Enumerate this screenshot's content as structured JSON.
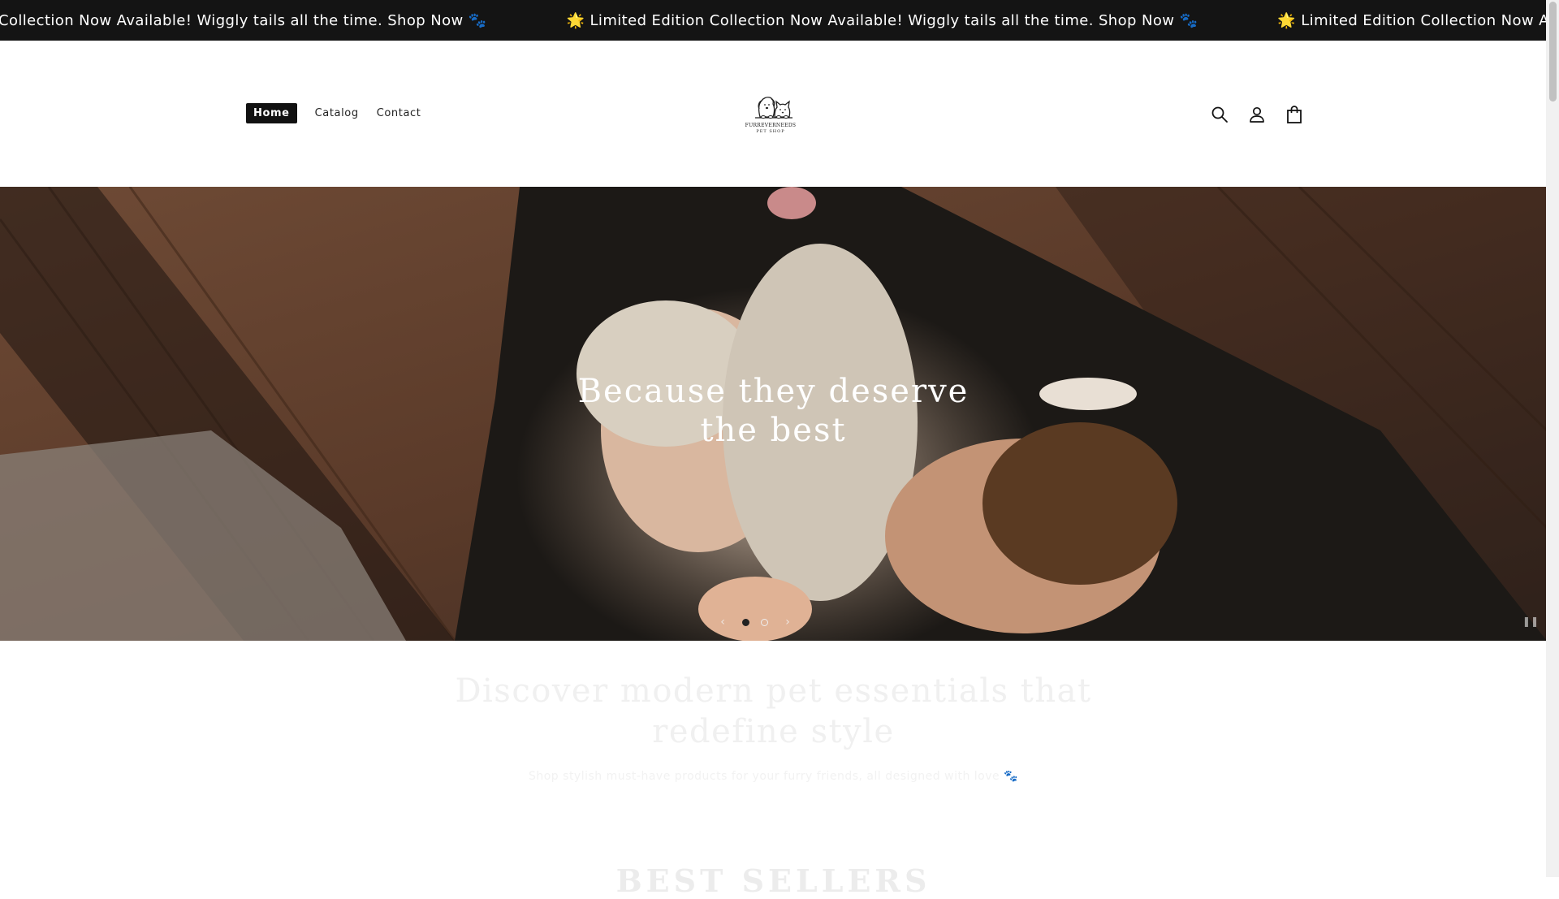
{
  "announcement": {
    "items": [
      "Collection Now Available! Wiggly tails all the time. Shop Now 🐾",
      "🌟 Limited Edition Collection Now Available! Wiggly tails all the time. Shop Now 🐾",
      "🌟 Limited Edition Collection Now Available! Wiggly tails all the time"
    ]
  },
  "nav": {
    "home": "Home",
    "catalog": "Catalog",
    "contact": "Contact"
  },
  "logo": {
    "name": "FURREVERNEEDS",
    "sub": "PET SHOP"
  },
  "hero": {
    "heading_line1": "Because they deserve",
    "heading_line2": "the best",
    "slides_total": 2,
    "slide_active": 1
  },
  "intro": {
    "title_line1": "Discover modern pet essentials that",
    "title_line2": "redefine style",
    "subtitle": "Shop stylish must-have products for your furry friends, all designed with love 🐾"
  },
  "section": {
    "best_sellers": "BEST SELLERS"
  },
  "colors": {
    "announcement_bg": "#141414",
    "accent": "#111111"
  }
}
